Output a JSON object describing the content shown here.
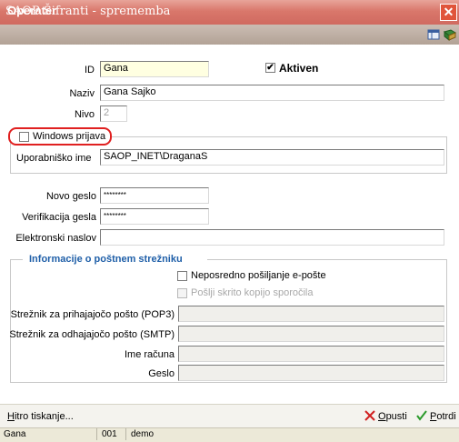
{
  "window": {
    "title": "SAOP Šifranti - sprememba",
    "close_glyph": "✕"
  },
  "header": {
    "title": "Operater"
  },
  "form": {
    "id_label": "ID",
    "id_value": "Gana",
    "aktiven_label": "Aktiven",
    "aktiven_checked": true,
    "naziv_label": "Naziv",
    "naziv_value": "Gana Sajko",
    "nivo_label": "Nivo",
    "nivo_value": "2",
    "windows_prijava_label": "Windows prijava",
    "windows_prijava_checked": false,
    "uporabnisko_label": "Uporabniško ime",
    "uporabnisko_value": "SAOP_INET\\DraganaS",
    "novo_geslo_label": "Novo geslo",
    "novo_geslo_value": "********",
    "verifikacija_label": "Verifikacija gesla",
    "verifikacija_value": "********",
    "email_label": "Elektronski naslov",
    "email_value": ""
  },
  "mail": {
    "section_title": "Informacije o poštnem strežniku",
    "neposredno_label": "Neposredno pošiljanje e-pošte",
    "skrito_label": "Pošlji skrito kopijo sporočila",
    "pop3_label": "Strežnik za prihajajočo pošto (POP3)",
    "smtp_label": "Strežnik za odhajajočo pošto (SMTP)",
    "ime_racuna_label": "Ime računa",
    "geslo_label": "Geslo"
  },
  "footer": {
    "hitro_tiskanje": "Hitro tiskanje...",
    "opusti": "Opusti",
    "potrdi": "Potrdi"
  },
  "status": {
    "user": "Gana",
    "code": "001",
    "db": "demo"
  },
  "colors": {
    "title_bar": "#d9776b",
    "accent_blue": "#1f5fa8",
    "highlight_red": "#e02020"
  }
}
